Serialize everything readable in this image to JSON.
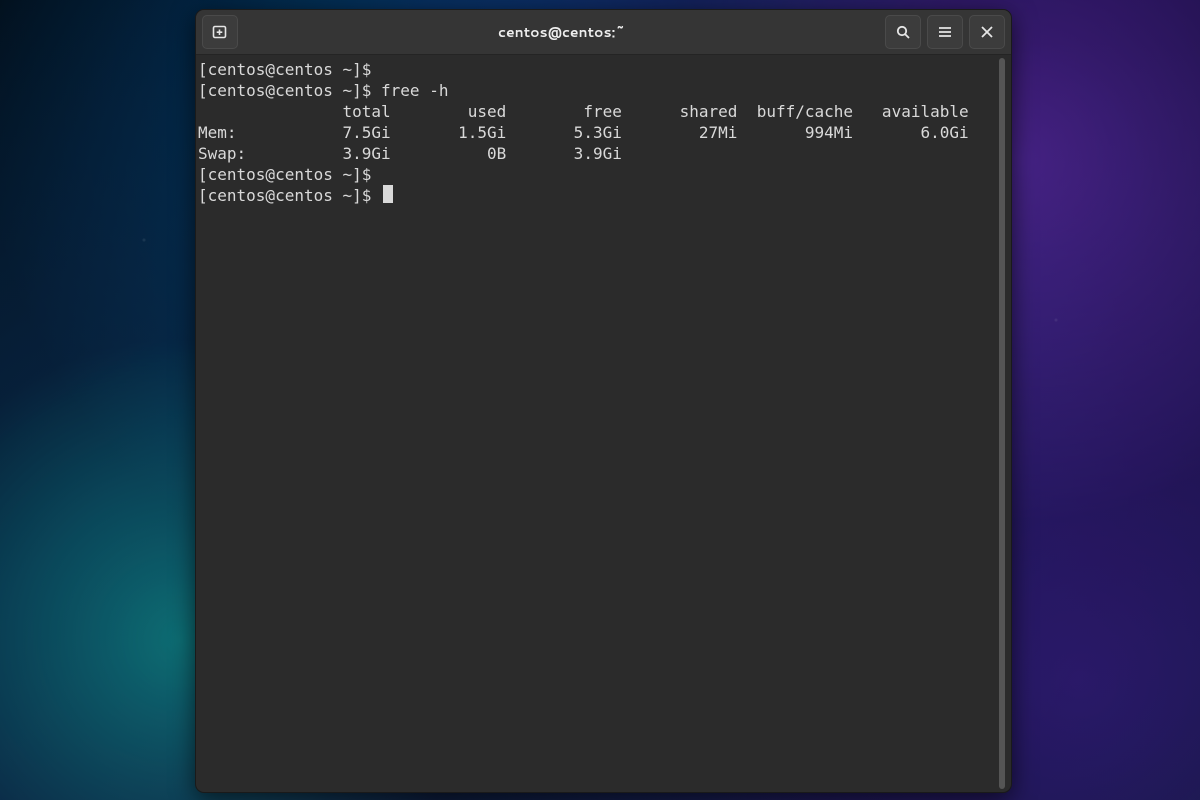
{
  "window": {
    "title": "centos@centos:~"
  },
  "icons": {
    "new_tab": "new-tab-icon",
    "search": "search-icon",
    "menu": "hamburger-icon",
    "close": "close-icon"
  },
  "prompt": "[centos@centos ~]$",
  "terminal": {
    "lines": [
      "[centos@centos ~]$ ",
      "[centos@centos ~]$ free -h",
      "               total        used        free      shared  buff/cache   available",
      "Mem:           7.5Gi       1.5Gi       5.3Gi        27Mi       994Mi       6.0Gi",
      "Swap:          3.9Gi          0B       3.9Gi",
      "[centos@centos ~]$ ",
      "[centos@centos ~]$ "
    ],
    "command": "free -h",
    "table": {
      "headers": [
        "",
        "total",
        "used",
        "free",
        "shared",
        "buff/cache",
        "available"
      ],
      "rows": [
        {
          "label": "Mem:",
          "total": "7.5Gi",
          "used": "1.5Gi",
          "free": "5.3Gi",
          "shared": "27Mi",
          "buff_cache": "994Mi",
          "available": "6.0Gi"
        },
        {
          "label": "Swap:",
          "total": "3.9Gi",
          "used": "0B",
          "free": "3.9Gi",
          "shared": "",
          "buff_cache": "",
          "available": ""
        }
      ]
    }
  },
  "colors": {
    "window_bg": "#2b2b2b",
    "titlebar_bg": "#353535",
    "text": "#d9d9d9"
  }
}
